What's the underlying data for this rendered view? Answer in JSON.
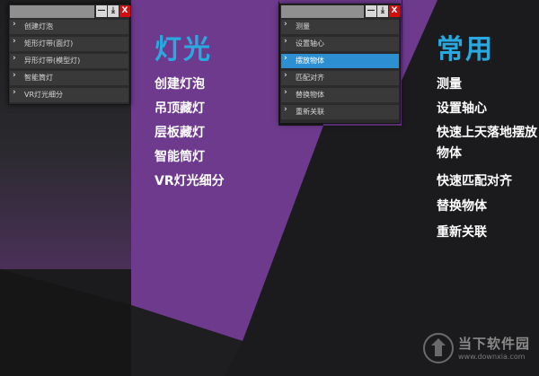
{
  "colors": {
    "background": "#1b1b1d",
    "purple": "#6e3a8e",
    "accent": "#2aa8e0",
    "active_item": "#2b8fd1"
  },
  "left_panel": {
    "window_buttons": [
      "—",
      "⤓",
      "X"
    ],
    "items": [
      {
        "label": "创建灯泡"
      },
      {
        "label": "矩形灯带(面灯)"
      },
      {
        "label": "异形灯带(模型灯)"
      },
      {
        "label": "智能筒灯"
      },
      {
        "label": "VR灯光细分"
      }
    ]
  },
  "right_panel": {
    "window_buttons": [
      "—",
      "⤓",
      "X"
    ],
    "items": [
      {
        "label": "测量"
      },
      {
        "label": "设置轴心"
      },
      {
        "label": "摆放物体",
        "active": true
      },
      {
        "label": "匹配对齐"
      },
      {
        "label": "替换物体"
      },
      {
        "label": "重新关联"
      }
    ]
  },
  "section_lighting": {
    "heading": "灯光",
    "features": [
      "创建灯泡",
      "吊顶藏灯",
      "层板藏灯",
      "智能筒灯",
      "VR灯光细分"
    ]
  },
  "section_common": {
    "heading": "常用",
    "features": [
      "测量",
      "设置轴心",
      "快速上天落地摆放",
      "物体",
      "快速匹配对齐",
      "替换物体",
      "重新关联"
    ]
  },
  "watermark": {
    "name": "当下软件园",
    "url": "www.downxia.com"
  }
}
